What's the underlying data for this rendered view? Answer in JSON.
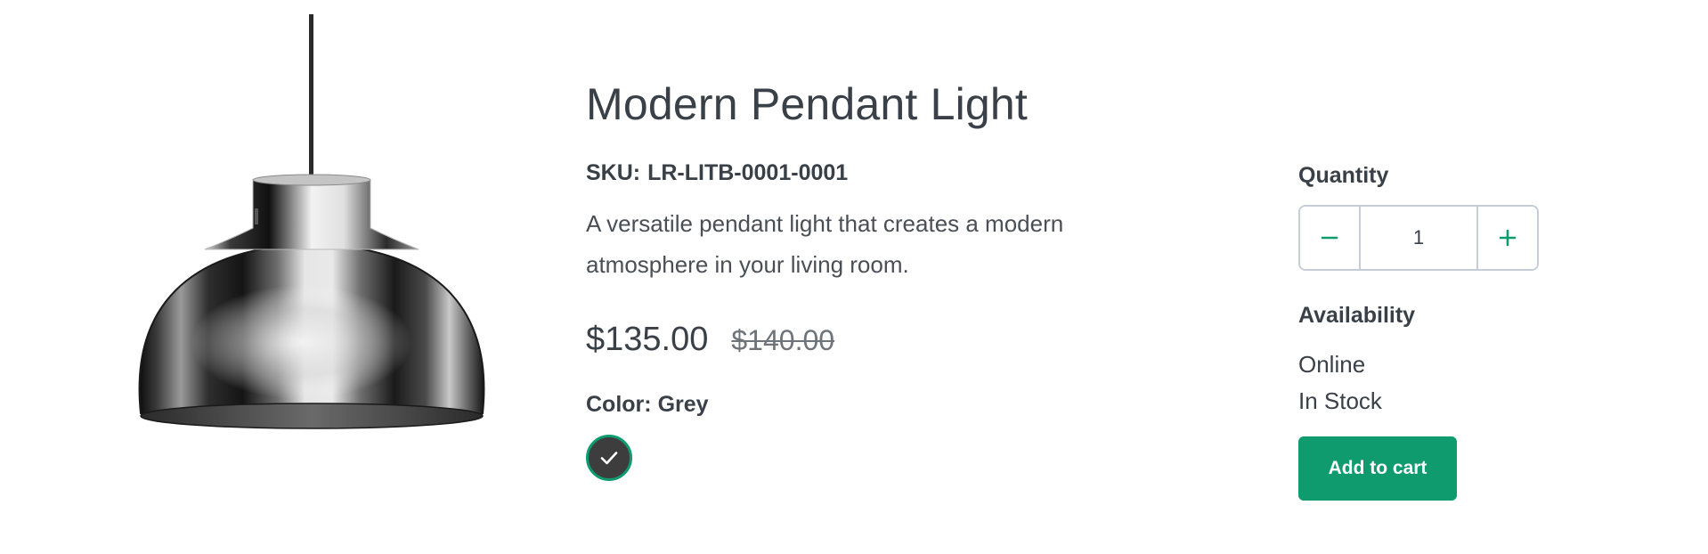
{
  "product": {
    "title": "Modern Pendant Light",
    "sku_label": "SKU:",
    "sku": "LR-LITB-0001-0001",
    "description": "A versatile pendant light that creates a modern atmosphere in your living room.",
    "price_current": "$135.00",
    "price_original": "$140.00",
    "color_label": "Color:",
    "color_value": "Grey",
    "image_icon": "pendant-lamp-image"
  },
  "swatches": [
    {
      "name": "Grey",
      "selected": true,
      "color": "#3d3d3d",
      "icon": "check-icon"
    }
  ],
  "purchase": {
    "quantity_label": "Quantity",
    "quantity_value": "1",
    "decrement_icon": "minus-icon",
    "increment_icon": "plus-icon",
    "availability_label": "Availability",
    "availability_channel": "Online",
    "availability_status": "In Stock",
    "add_to_cart_label": "Add to cart"
  },
  "colors": {
    "accent": "#0f9b6e",
    "text": "#3a4047",
    "border": "#c7cdd6",
    "swatch_grey": "#3d3d3d"
  }
}
